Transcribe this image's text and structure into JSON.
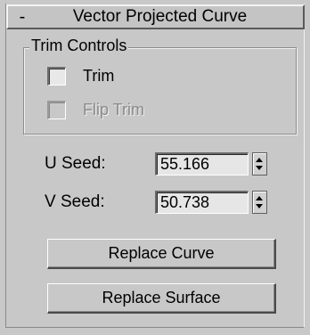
{
  "rollout": {
    "collapse_sign": "-",
    "title": "Vector Projected Curve"
  },
  "trim_controls": {
    "group_label": "Trim Controls",
    "trim": {
      "label": "Trim",
      "checked": false,
      "enabled": true
    },
    "flip_trim": {
      "label": "Flip Trim",
      "checked": false,
      "enabled": false
    }
  },
  "seeds": {
    "u": {
      "label": "U Seed:",
      "value": "55.166"
    },
    "v": {
      "label": "V Seed:",
      "value": "50.738"
    }
  },
  "buttons": {
    "replace_curve": "Replace Curve",
    "replace_surface": "Replace Surface"
  }
}
